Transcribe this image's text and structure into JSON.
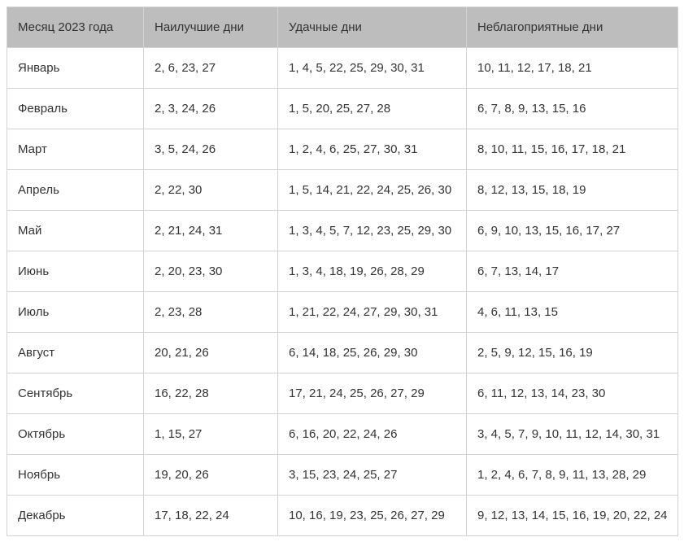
{
  "table": {
    "headers": [
      "Месяц 2023 года",
      "Наилучшие дни",
      "Удачные дни",
      "Неблагоприятные дни"
    ],
    "rows": [
      [
        "Январь",
        "2, 6, 23, 27",
        "1, 4, 5, 22, 25, 29, 30, 31",
        "10, 11, 12, 17, 18, 21"
      ],
      [
        "Февраль",
        "2, 3, 24, 26",
        "1, 5, 20, 25, 27, 28",
        "6, 7, 8, 9, 13, 15, 16"
      ],
      [
        "Март",
        "3, 5, 24, 26",
        "1, 2, 4, 6, 25, 27, 30, 31",
        "8, 10, 11, 15, 16, 17, 18, 21"
      ],
      [
        "Апрель",
        "2, 22, 30",
        "1, 5, 14, 21, 22, 24, 25, 26, 30",
        "8, 12, 13, 15, 18, 19"
      ],
      [
        "Май",
        "2, 21, 24, 31",
        "1, 3, 4, 5, 7, 12, 23, 25, 29, 30",
        "6, 9, 10, 13, 15, 16, 17, 27"
      ],
      [
        "Июнь",
        "2, 20, 23, 30",
        "1, 3, 4, 18, 19, 26, 28, 29",
        "6, 7, 13, 14, 17"
      ],
      [
        "Июль",
        "2, 23, 28",
        "1, 21, 22, 24, 27, 29, 30, 31",
        "4, 6, 11, 13, 15"
      ],
      [
        "Август",
        "20, 21, 26",
        "6, 14, 18, 25, 26, 29, 30",
        "2, 5, 9, 12, 15, 16, 19"
      ],
      [
        "Сентябрь",
        "16, 22, 28",
        "17, 21, 24, 25, 26, 27, 29",
        "6, 11, 12, 13, 14, 23, 30"
      ],
      [
        "Октябрь",
        "1, 15, 27",
        "6, 16, 20, 22, 24, 26",
        "3, 4, 5, 7, 9, 10, 11, 12, 14, 30, 31"
      ],
      [
        "Ноябрь",
        "19, 20, 26",
        "3, 15, 23, 24, 25, 27",
        "1, 2, 4, 6, 7, 8, 9, 11, 13, 28, 29"
      ],
      [
        "Декабрь",
        "17, 18, 22, 24",
        "10, 16, 19, 23, 25, 26, 27, 29",
        "9, 12, 13, 14, 15, 16, 19, 20, 22, 24"
      ]
    ]
  },
  "colors": {
    "header_background": "#bdbdbd",
    "border": "#d3d3d3",
    "text": "#333333"
  }
}
